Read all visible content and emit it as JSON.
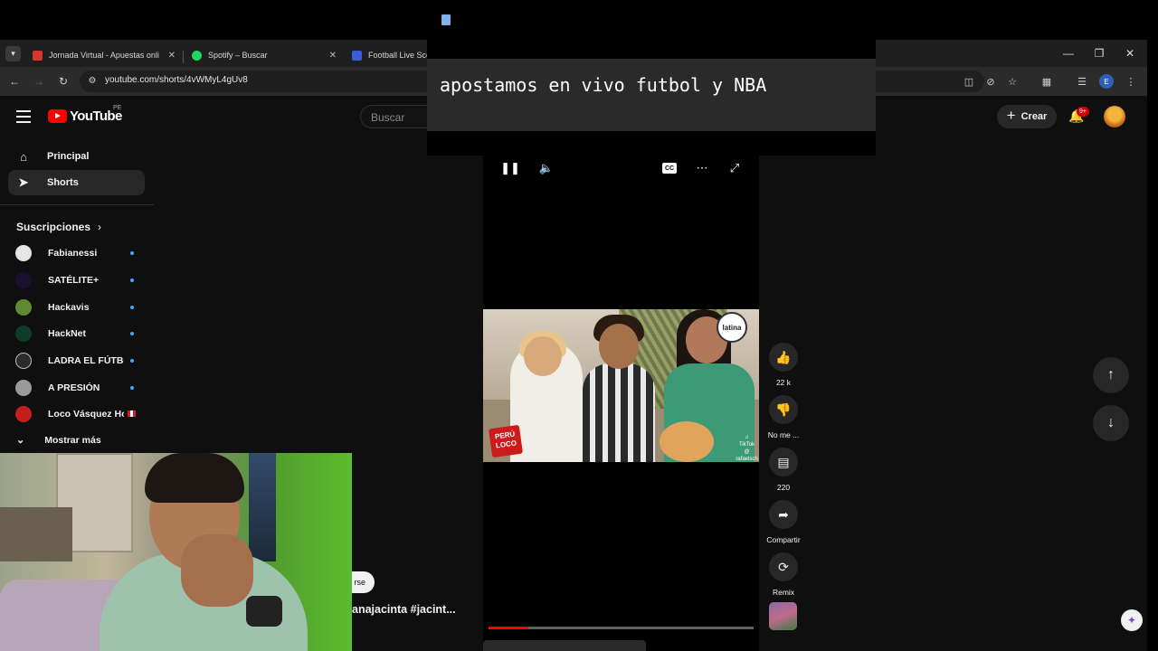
{
  "browser": {
    "tabs": [
      {
        "title": "Jornada Virtual - Apuestas onli",
        "favicon_color": "#d6372e"
      },
      {
        "title": "Spotify – Buscar",
        "favicon_color": "#1ed760"
      },
      {
        "title": "Football Live Sco",
        "favicon_color": "#3b5bdb"
      }
    ],
    "url": "youtube.com/shorts/4vWMyL4gUv8",
    "profile_initial": "E"
  },
  "youtube": {
    "logo_text": "YouTube",
    "region": "PE",
    "search_placeholder": "Buscar",
    "create_label": "Crear",
    "notification_count": "9+",
    "nav": [
      {
        "label": "Principal",
        "icon": "home-icon"
      },
      {
        "label": "Shorts",
        "icon": "shorts-icon"
      }
    ],
    "subscriptions_title": "Suscripciones",
    "subscriptions": [
      {
        "name": "Fabianessi",
        "avatar_color": "#e5e5e5",
        "indicator": "dot"
      },
      {
        "name": "SATÉLITE+",
        "avatar_color": "#1a1030",
        "indicator": "dot"
      },
      {
        "name": "Hackavis",
        "avatar_color": "#5f8a2f",
        "indicator": "dot"
      },
      {
        "name": "HackNet",
        "avatar_color": "#0e3b2a",
        "indicator": "dot"
      },
      {
        "name": "LADRA EL FÚTBOL",
        "avatar_color": "#2b2b2b",
        "indicator": "dot"
      },
      {
        "name": "A PRESIÓN",
        "avatar_color": "#9a9a9a",
        "indicator": "dot"
      },
      {
        "name": "Loco Vásquez Hoy",
        "avatar_color": "#c21e1e",
        "indicator": "live"
      }
    ],
    "show_more": "Mostrar más"
  },
  "overlay": {
    "caption": "apostamos en vivo futbol y NBA"
  },
  "short": {
    "actions": [
      {
        "name": "like",
        "icon": "thumbs-up-icon",
        "label": "22 k"
      },
      {
        "name": "dislike",
        "icon": "thumbs-down-icon",
        "label": "No me ..."
      },
      {
        "name": "comments",
        "icon": "comment-icon",
        "label": "220"
      },
      {
        "name": "share",
        "icon": "share-icon",
        "label": "Compartir"
      },
      {
        "name": "remix",
        "icon": "remix-icon",
        "label": "Remix"
      }
    ],
    "channel_logo": "latina",
    "brand_text": "PERÚ LOCO",
    "tiktok_text": "TikTok",
    "tiktok_handle": "@ rafaelsch",
    "progress": 0.15,
    "subscribe_chip": "rse",
    "hashtags": "anajacinta #jacint..."
  }
}
